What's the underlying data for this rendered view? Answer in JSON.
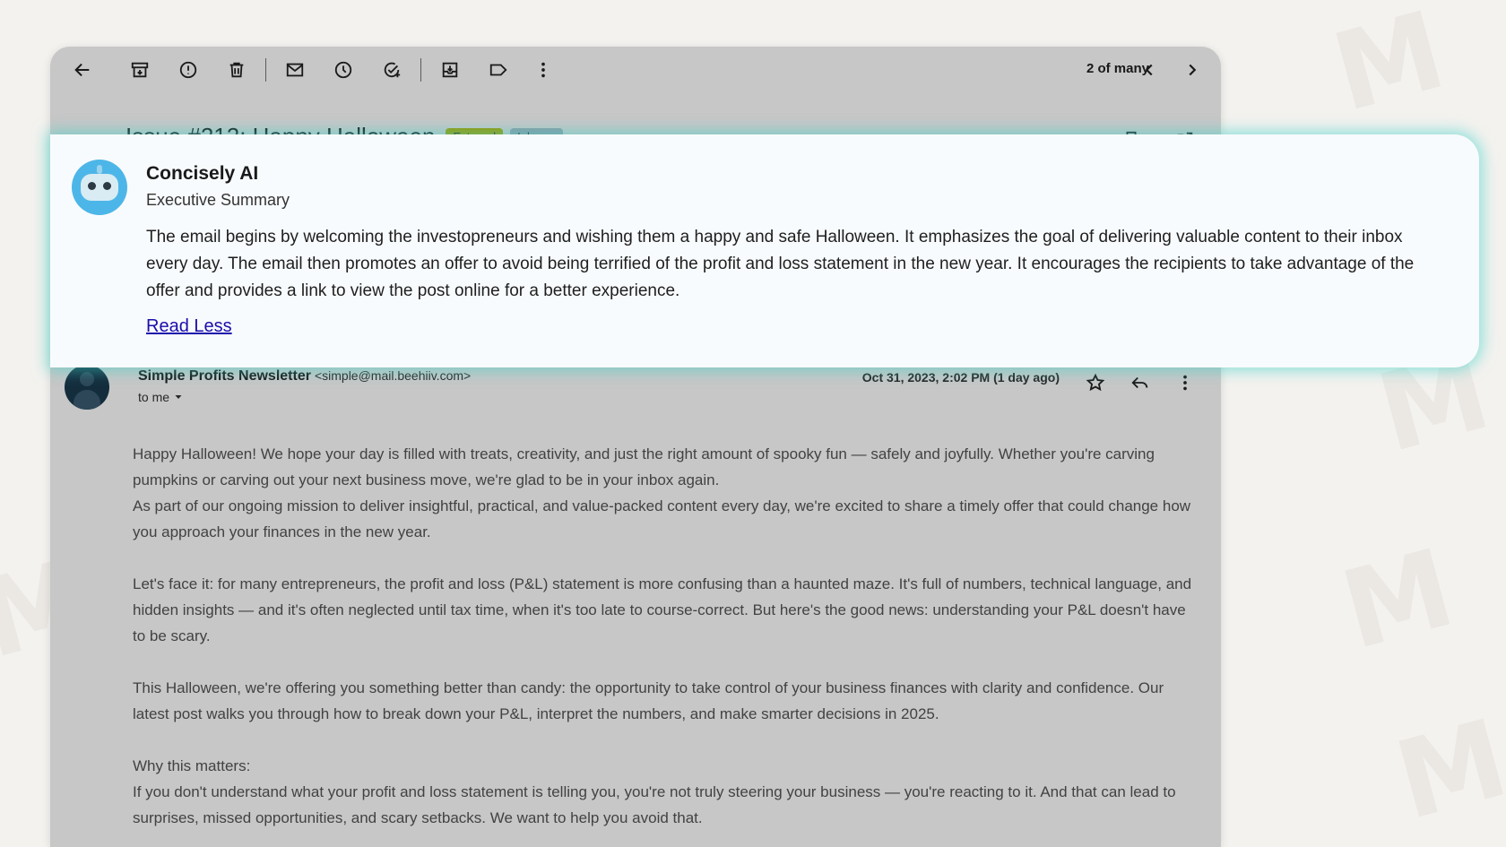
{
  "toolbar": {
    "icons": [
      "back-arrow-icon",
      "archive-icon",
      "report-spam-icon",
      "delete-icon",
      "mark-unread-icon",
      "snooze-icon",
      "add-task-icon",
      "move-to-icon",
      "label-icon",
      "more-vert-icon"
    ],
    "pager": "2 of many"
  },
  "email": {
    "subject": "Issue #212: Happy Halloween",
    "tags": [
      "External",
      "Inbox ×"
    ],
    "sender_name": "Simple Profits Newsletter",
    "sender_email": "<simple@mail.beehiiv.com>",
    "to": "to me",
    "date": "Oct 31, 2023, 2:02 PM (1 day ago)",
    "body": [
      "Happy Halloween! We hope your day is filled with treats, creativity, and just the right amount of spooky fun — safely and joyfully. Whether you're carving pumpkins or carving out your next business move, we're glad to be in your inbox again.",
      "As part of our ongoing mission to deliver insightful, practical, and value-packed content every day, we're excited to share a timely offer that could change how you approach your finances in the new year.",
      "Let's face it: for many entrepreneurs, the profit and loss (P&L) statement is more confusing than a haunted maze. It's full of numbers, technical language, and hidden insights — and it's often neglected until tax time, when it's too late to course-correct. But here's the good news: understanding your P&L doesn't have to be scary.",
      "This Halloween, we're offering you something better than candy: the opportunity to take control of your business finances with clarity and confidence. Our latest post walks you through how to break down your P&L, interpret the numbers, and make smarter decisions in 2025.",
      "Why this matters:",
      "If you don't understand what your profit and loss statement is telling you, you're not truly steering your business — you're reacting to it. And that can lead to surprises, missed opportunities, and scary setbacks. We want to help you avoid that."
    ]
  },
  "summary": {
    "title": "Concisely AI",
    "subtitle": "Executive Summary",
    "text": "The email begins by welcoming the investopreneurs and wishing them a happy and safe Halloween. It emphasizes the goal of delivering valuable content to their inbox every day. The email then promotes an offer to avoid being terrified of the profit and loss statement in the new year. It encourages the recipients to take advantage of the offer and provides a link to view the post online for a better experience.",
    "link": "Read Less"
  },
  "colors": {
    "card_glow": "#40d2c8",
    "link": "#1a0dab",
    "bot_avatar": "#4db6e8"
  }
}
